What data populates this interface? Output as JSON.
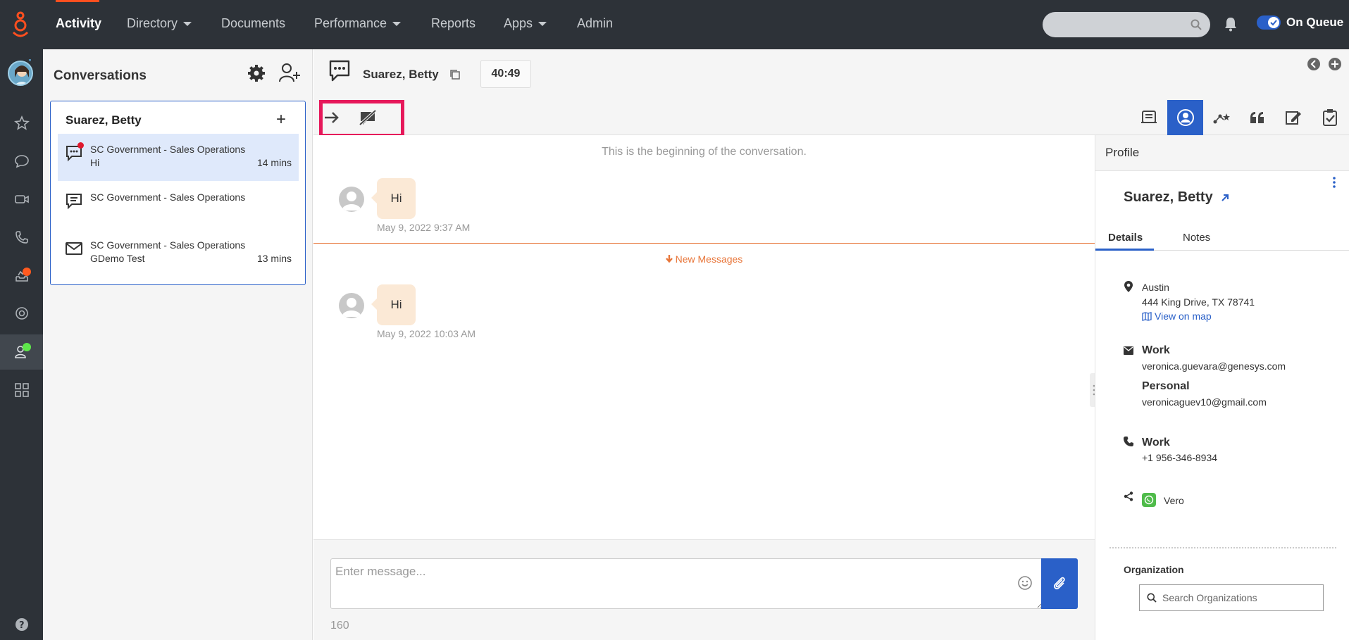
{
  "nav": {
    "items": [
      {
        "label": "Activity"
      },
      {
        "label": "Directory"
      },
      {
        "label": "Documents"
      },
      {
        "label": "Performance"
      },
      {
        "label": "Reports"
      },
      {
        "label": "Apps"
      },
      {
        "label": "Admin"
      }
    ],
    "status": "On Queue",
    "accent": "#ff4f1f"
  },
  "conversations": {
    "title": "Conversations",
    "contact_name": "Suarez, Betty",
    "rows": [
      {
        "line1": "SC Government - Sales Operations",
        "line2": "Hi",
        "time": "14 mins",
        "icon": "chat-icon"
      },
      {
        "line1": "SC Government - Sales Operations",
        "line2": "",
        "time": "",
        "icon": "message-icon"
      },
      {
        "line1": "SC Government - Sales Operations",
        "line2": "GDemo Test",
        "time": "13 mins",
        "icon": "email-icon"
      }
    ]
  },
  "header": {
    "name": "Suarez, Betty",
    "timer": "40:49"
  },
  "transcript": {
    "begin": "This is the beginning of the conversation.",
    "new_messages": "New Messages",
    "messages": [
      {
        "text": "Hi",
        "time": "May 9, 2022 9:37 AM"
      },
      {
        "text": "Hi",
        "time": "May 9, 2022 10:03 AM"
      }
    ]
  },
  "composer": {
    "placeholder": "Enter message...",
    "count": "160"
  },
  "profile": {
    "title": "Profile",
    "name": "Suarez, Betty",
    "tabs": [
      "Details",
      "Notes"
    ],
    "city": "Austin",
    "address": "444 King Drive, TX 78741",
    "map_link": "View on map",
    "work_email_label": "Work",
    "work_email": "veronica.guevara@genesys.com",
    "personal_email_label": "Personal",
    "personal_email": "veronicaguev10@gmail.com",
    "phone_label": "Work",
    "phone": "+1 956-346-8934",
    "social": "Vero",
    "org_label": "Organization",
    "org_placeholder": "Search Organizations"
  },
  "colors": {
    "nav_bg": "#2d3238",
    "primary": "#2a60c8",
    "bubble": "#fbe9d6",
    "new_messages": "#e8763a",
    "highlight": "#e6185a"
  }
}
